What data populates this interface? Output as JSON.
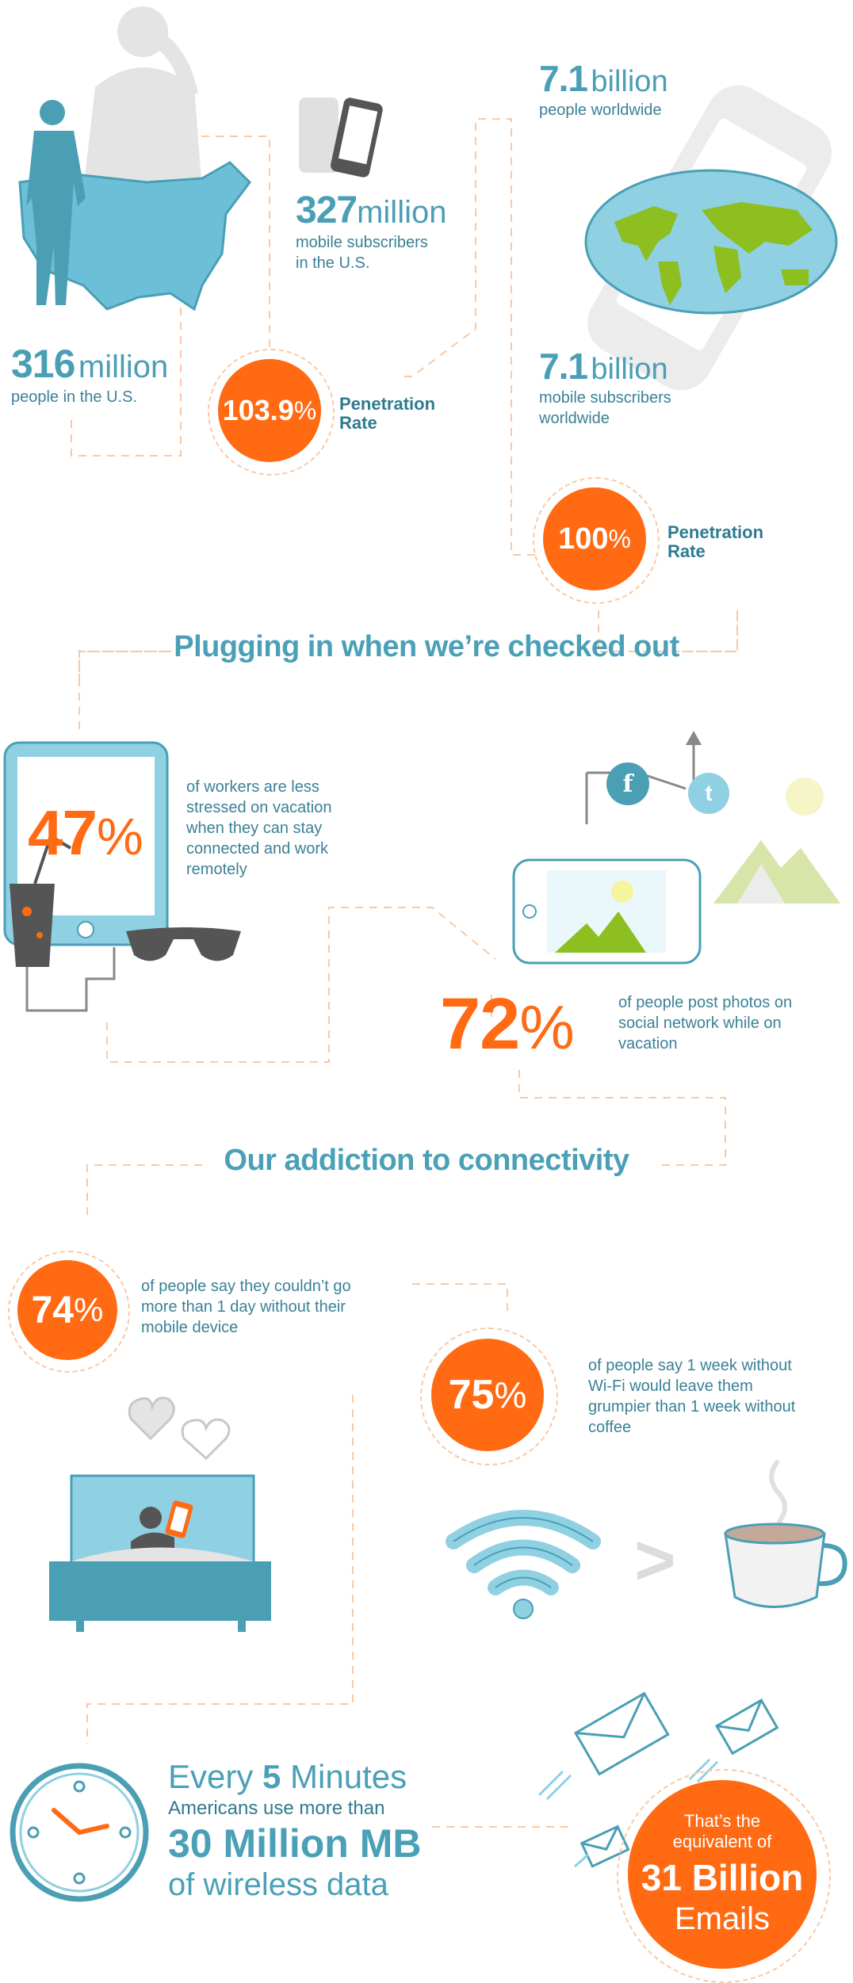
{
  "us": {
    "population_number": "316",
    "population_unit": "million",
    "population_label": "people in the U.S.",
    "subscribers_number": "327",
    "subscribers_unit": "million",
    "subscribers_label_line1": "mobile subscribers",
    "subscribers_label_line2": "in the U.S.",
    "penetration_value": "103.9",
    "penetration_percent": "%",
    "penetration_label_line1": "Penetration",
    "penetration_label_line2": "Rate"
  },
  "world": {
    "population_number": "7.1",
    "population_unit": "billion",
    "population_label": "people worldwide",
    "subscribers_number": "7.1",
    "subscribers_unit": "billion",
    "subscribers_label_line1": "mobile subscribers",
    "subscribers_label_line2": "worldwide",
    "penetration_value": "100",
    "penetration_percent": "%",
    "penetration_label_line1": "Penetration",
    "penetration_label_line2": "Rate"
  },
  "section1": {
    "title": "Plugging in when we’re checked out",
    "stat1_value": "47",
    "stat1_percent": "%",
    "stat1_lines": [
      "of workers are less",
      "stressed on vacation",
      "when they can stay",
      "connected and work",
      "remotely"
    ],
    "stat2_value": "72",
    "stat2_percent": "%",
    "stat2_lines": [
      "of people post photos on",
      "social network while on",
      "vacation"
    ],
    "facebook_glyph": "f",
    "twitter_glyph": "t"
  },
  "section2": {
    "title": "Our addiction to connectivity",
    "stat1_value": "74",
    "stat1_percent": "%",
    "stat1_lines": [
      "of people say they couldn’t go",
      "more than 1 day without their",
      "mobile device"
    ],
    "stat2_value": "75",
    "stat2_percent": "%",
    "stat2_lines": [
      "of people say 1 week without",
      "Wi-Fi would leave them",
      "grumpier than 1 week without",
      "coffee"
    ],
    "greater_than": ">"
  },
  "data_usage": {
    "every_prefix": "Every ",
    "every_number": "5",
    "every_suffix": " Minutes",
    "line2": "Americans use more than",
    "amount": "30 Million MB",
    "line4": "of wireless data",
    "equiv_line1": "That’s the",
    "equiv_line2": "equivalent of",
    "emails_number": "31 Billion",
    "emails_label": "Emails"
  },
  "colors": {
    "orange": "#ff6a13",
    "teal": "#4a9fb5",
    "light_blue": "#8fd0e2",
    "green": "#8cbf1f",
    "gray": "#e2e2e2"
  }
}
